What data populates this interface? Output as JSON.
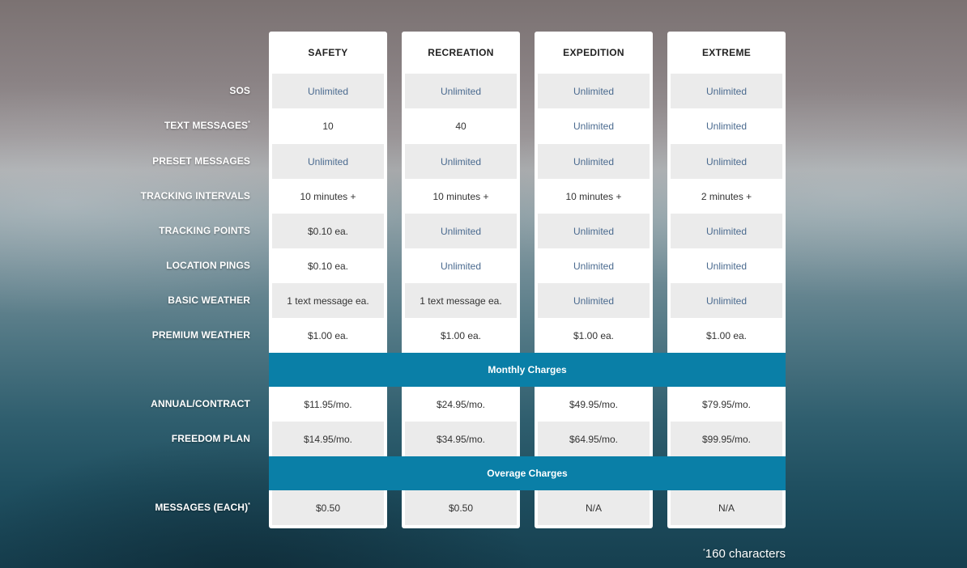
{
  "plans": [
    "SAFETY",
    "RECREATION",
    "EXPEDITION",
    "EXTREME"
  ],
  "features": [
    {
      "label": "SOS",
      "sup": "",
      "values": [
        "Unlimited",
        "Unlimited",
        "Unlimited",
        "Unlimited"
      ]
    },
    {
      "label": "TEXT MESSAGES",
      "sup": "*",
      "values": [
        "10",
        "40",
        "Unlimited",
        "Unlimited"
      ]
    },
    {
      "label": "PRESET MESSAGES",
      "sup": "",
      "values": [
        "Unlimited",
        "Unlimited",
        "Unlimited",
        "Unlimited"
      ]
    },
    {
      "label": "TRACKING INTERVALS",
      "sup": "",
      "values": [
        "10 minutes +",
        "10 minutes +",
        "10 minutes +",
        "2 minutes +"
      ]
    },
    {
      "label": "TRACKING POINTS",
      "sup": "",
      "values": [
        "$0.10 ea.",
        "Unlimited",
        "Unlimited",
        "Unlimited"
      ]
    },
    {
      "label": "LOCATION PINGS",
      "sup": "",
      "values": [
        "$0.10 ea.",
        "Unlimited",
        "Unlimited",
        "Unlimited"
      ]
    },
    {
      "label": "BASIC WEATHER",
      "sup": "",
      "values": [
        "1 text message ea.",
        "1 text message ea.",
        "Unlimited",
        "Unlimited"
      ]
    },
    {
      "label": "PREMIUM WEATHER",
      "sup": "",
      "values": [
        "$1.00 ea.",
        "$1.00 ea.",
        "$1.00 ea.",
        "$1.00 ea."
      ]
    }
  ],
  "monthly": {
    "title": "Monthly Charges",
    "rows": [
      {
        "label": "ANNUAL/CONTRACT",
        "sup": "",
        "values": [
          "$11.95/mo.",
          "$24.95/mo.",
          "$49.95/mo.",
          "$79.95/mo."
        ]
      },
      {
        "label": "FREEDOM PLAN",
        "sup": "",
        "values": [
          "$14.95/mo.",
          "$34.95/mo.",
          "$64.95/mo.",
          "$99.95/mo."
        ]
      }
    ]
  },
  "overage": {
    "title": "Overage Charges",
    "rows": [
      {
        "label": "MESSAGES (EACH)",
        "sup": "*",
        "values": [
          "$0.50",
          "$0.50",
          "N/A",
          "N/A"
        ]
      }
    ]
  },
  "footnote": {
    "sup": "*",
    "text": "160 characters"
  },
  "colors": {
    "band": "#0a7fa7",
    "unlimited": "#4a6a8f",
    "shade": "#ebebeb"
  }
}
